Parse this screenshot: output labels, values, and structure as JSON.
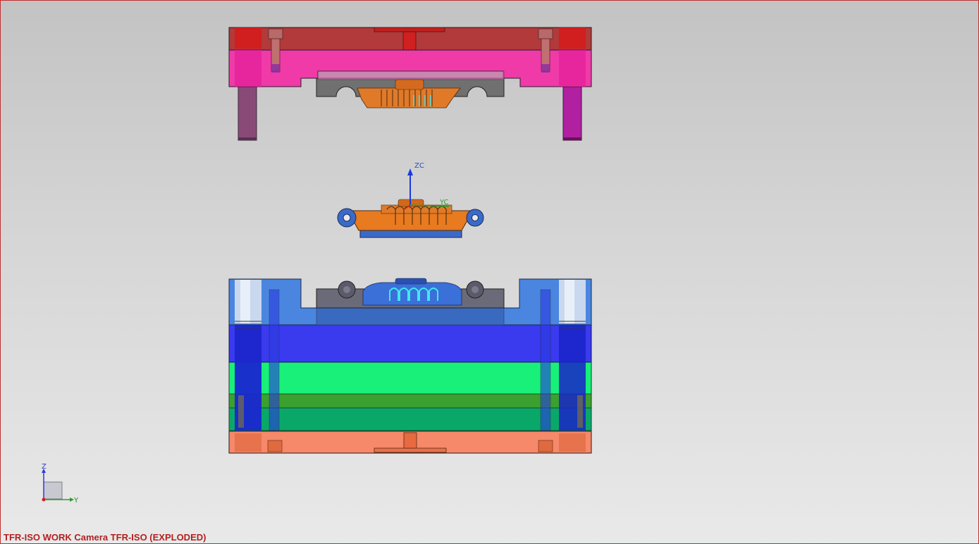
{
  "viewport": {
    "status_text": "TFR-ISO WORK Camera TFR-ISO (EXPLODED)",
    "background": [
      "#c3c3c3",
      "#e9e9e9"
    ],
    "border_color": "#c03030"
  },
  "wcs": {
    "z_label": "ZC",
    "y_label": "YC"
  },
  "triad": {
    "z_label": "Z",
    "y_label": "Y"
  },
  "colors": {
    "top_clamp_plate": "#b23a3a",
    "cavity_plate": "#f03aa8",
    "cavity_insert": "#6e6e6e",
    "molded_part": "#e07a28",
    "core_plate": "#3a7adf",
    "support_plate": "#3030e8",
    "spacer_block": "#18f07a",
    "ejector_plate": "#0aa868",
    "bottom_clamp_plate": "#f5896a",
    "cooling_channel": "#40e8f0"
  },
  "icons": [
    "datum-csys-icon",
    "view-triad-icon"
  ]
}
